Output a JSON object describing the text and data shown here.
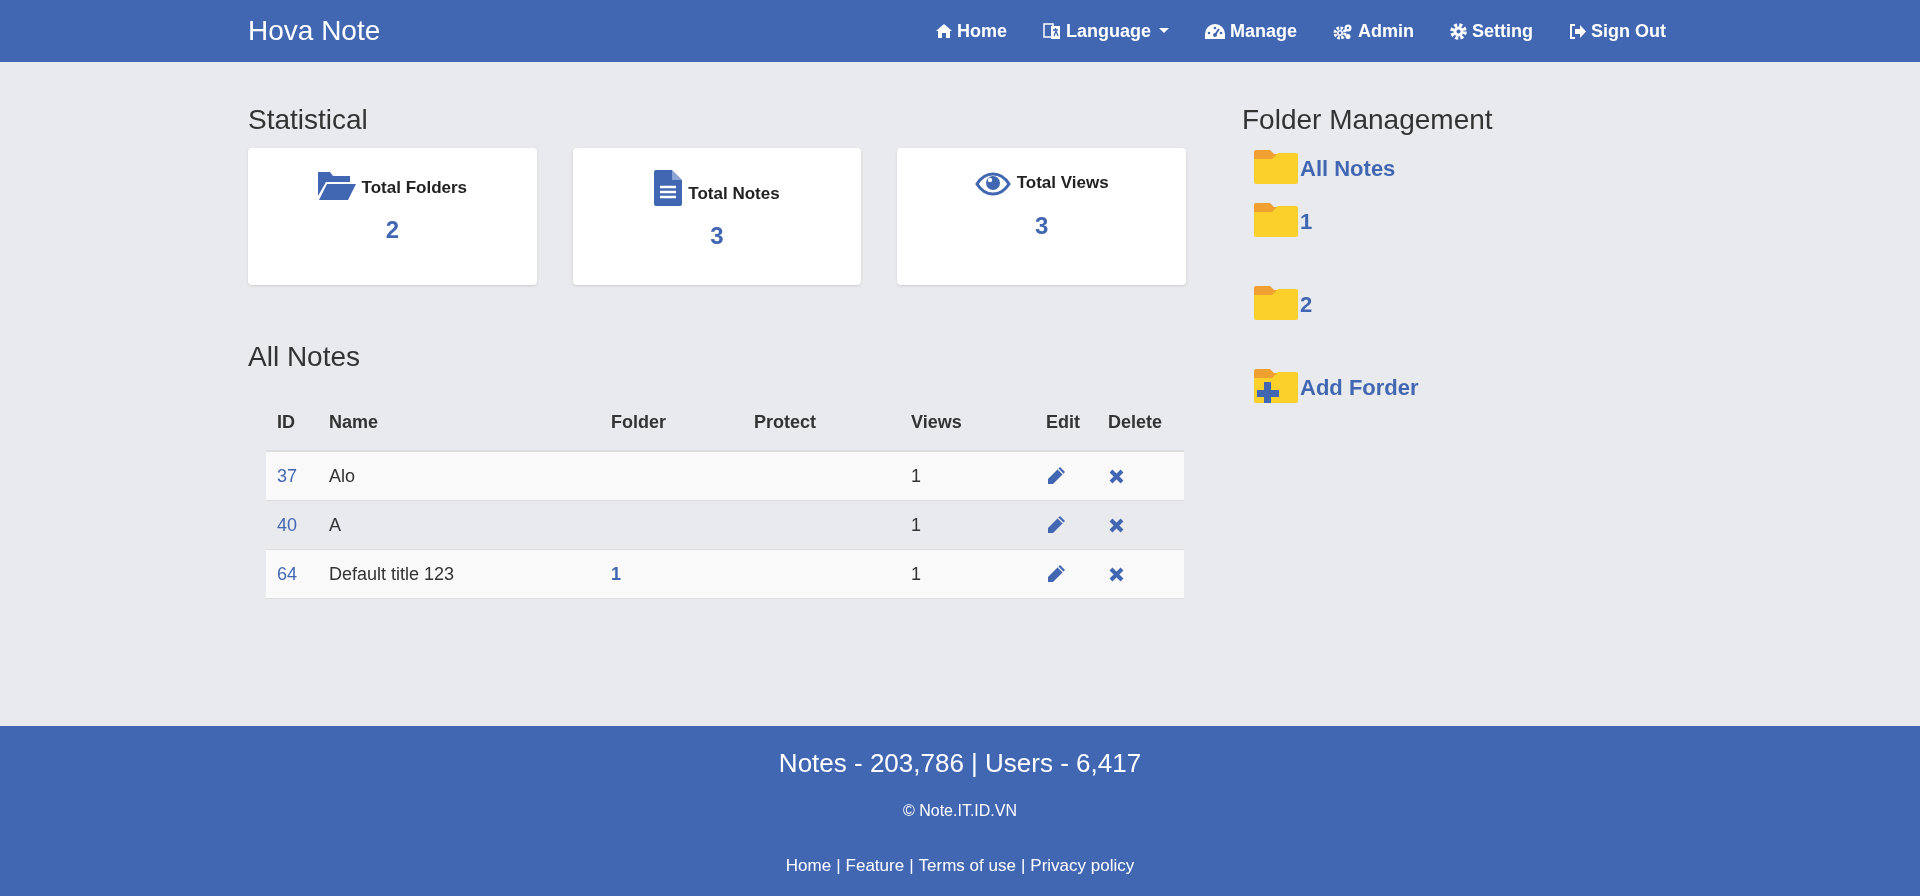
{
  "navbar": {
    "brand": "Hova Note",
    "items": [
      {
        "kind": "home",
        "label": "Home"
      },
      {
        "kind": "language",
        "label": "Language",
        "dropdown": true
      },
      {
        "kind": "manage",
        "label": "Manage"
      },
      {
        "kind": "admin",
        "label": "Admin"
      },
      {
        "kind": "setting",
        "label": "Setting"
      },
      {
        "kind": "signout",
        "label": "Sign Out"
      }
    ]
  },
  "statistical": {
    "title": "Statistical",
    "cards": [
      {
        "kind": "folders",
        "label": "Total Folders",
        "value": "2"
      },
      {
        "kind": "notes",
        "label": "Total Notes",
        "value": "3"
      },
      {
        "kind": "views",
        "label": "Total Views",
        "value": "3"
      }
    ]
  },
  "all_notes": {
    "title": "All Notes",
    "columns": [
      "ID",
      "Name",
      "Folder",
      "Protect",
      "Views",
      "Edit",
      "Delete"
    ],
    "rows": [
      {
        "id": "37",
        "name": "Alo",
        "views": "1"
      },
      {
        "id": "40",
        "name": "A",
        "views": "1"
      },
      {
        "id": "64",
        "name": "Default title 123",
        "folder": "1",
        "views": "1"
      }
    ]
  },
  "folder_management": {
    "title": "Folder Management",
    "items": [
      {
        "kind": "folder",
        "label": "All Notes"
      },
      {
        "kind": "folder",
        "label": "1"
      },
      {
        "kind": "folder",
        "label": "2"
      },
      {
        "kind": "add",
        "label": "Add Forder"
      }
    ]
  },
  "footer": {
    "stats": "Notes - 203,786 | Users - 6,417",
    "copyright": "© Note.IT.ID.VN",
    "link_separator": "|",
    "links": [
      "Home",
      "Feature",
      "Terms of use",
      "Privacy policy"
    ]
  }
}
